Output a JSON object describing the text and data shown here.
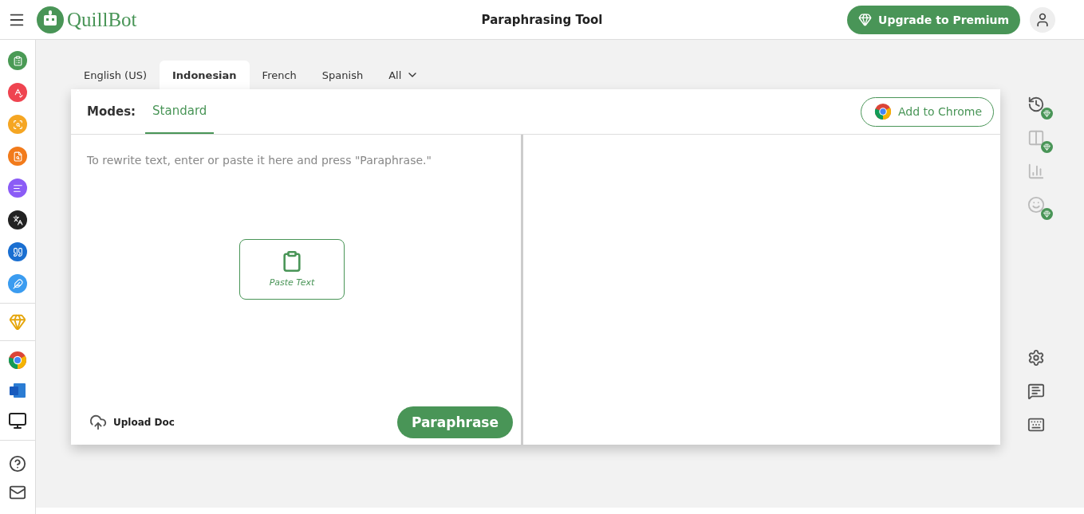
{
  "header": {
    "logo_text": "QuillBot",
    "title": "Paraphrasing Tool",
    "upgrade_button": "Upgrade to Premium"
  },
  "language_tabs": [
    {
      "label": "English (US)",
      "selected": false
    },
    {
      "label": "Indonesian",
      "selected": true
    },
    {
      "label": "French",
      "selected": false
    },
    {
      "label": "Spanish",
      "selected": false
    },
    {
      "label": "All",
      "selected": false,
      "kind": "dropdown"
    }
  ],
  "modes": {
    "label": "Modes:",
    "items": [
      {
        "label": "Standard",
        "selected": true
      }
    ]
  },
  "add_to_chrome": "Add to Chrome",
  "input": {
    "placeholder": "To rewrite text, enter or paste it here and press \"Paraphrase.\"",
    "paste_button": "Paste Text",
    "upload_button": "Upload Doc",
    "paraphrase_button": "Paraphrase"
  }
}
